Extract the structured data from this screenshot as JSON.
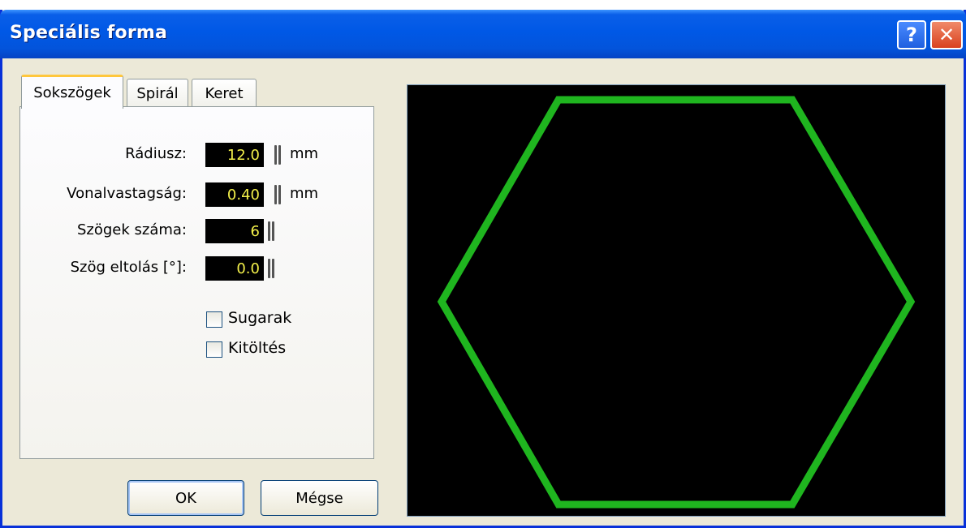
{
  "window": {
    "title": "Speciális forma",
    "help_label": "?",
    "close_label": "✕"
  },
  "tabs": [
    {
      "label": "Sokszögek",
      "active": true
    },
    {
      "label": "Spirál",
      "active": false
    },
    {
      "label": "Keret",
      "active": false
    }
  ],
  "form": {
    "radius": {
      "label": "Rádiusz:",
      "value": "12.0",
      "unit": "mm"
    },
    "line_width": {
      "label": "Vonalvastagság:",
      "value": "0.40",
      "unit": "mm"
    },
    "sides": {
      "label": "Szögek száma:",
      "value": "6"
    },
    "angle_offset": {
      "label": "Szög eltolás [°]:",
      "value": "0.0"
    },
    "rays": {
      "label": "Sugarak",
      "checked": false
    },
    "fill": {
      "label": "Kitöltés",
      "checked": false
    }
  },
  "buttons": {
    "ok": "OK",
    "cancel": "Mégse"
  },
  "preview": {
    "shape": "hexagon",
    "sides": 6,
    "stroke_color": "#1fb51f",
    "background": "#000000"
  }
}
